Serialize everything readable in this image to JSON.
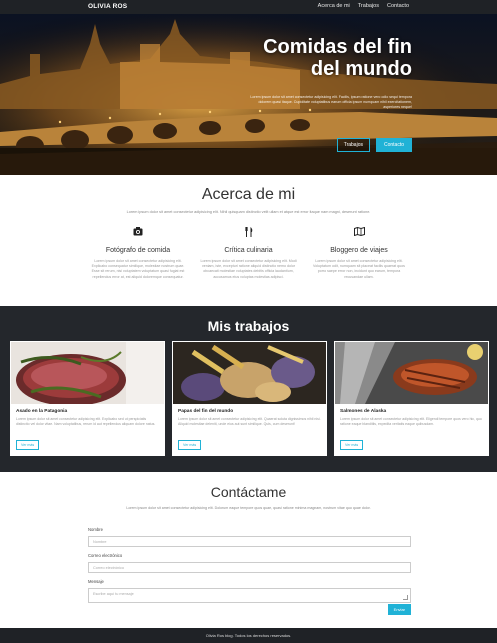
{
  "nav": {
    "brand": "OLIVIA ROS",
    "links": [
      "Acerca de mi",
      "Trabajos",
      "Contacto"
    ]
  },
  "hero": {
    "title": "Comidas del fin del mundo",
    "subtitle": "Lorem ipsum dolor sit amet consectetur adipisicing elit. Facilis, ipsum ratione vero odio sequi tempora dolorem quasi itaque. Cupiditate voluptatibus earum officia ipsum numquam nihil exercitationem, asperiores neque!",
    "buttons": [
      "Trabajos",
      "Contacto"
    ]
  },
  "about": {
    "title": "Acerca de mi",
    "lead": "Lorem ipsum dolor sit amet consectetur adipisicing elit. Nihil quisquam distinctio velit ullam et atque est error itaque nam magni, deserunt ratione.",
    "features": [
      {
        "icon": "camera-icon",
        "title": "Fotógrafo de comida",
        "text": "Lorem ipsum dolor sit amet consectetur adipisicing elit. Explicabo consequatur similique, molestiae nostrum quae. Esse sit rerum, nisi voluptatem voluptatum quasi fugiat est repellendus error at, est aliquid doloremque consequatur."
      },
      {
        "icon": "cutlery-icon",
        "title": "Crítica culinaria",
        "text": "Lorem ipsum dolor sit amet consectetur adipisicing elit. Modi veniam, iste, excepturi ratione aliquid distinctio nemo dolor obcaecati molestiae voluptates debitis officia laudantium, accusamus eius voluptas molestias adipisci."
      },
      {
        "icon": "map-icon",
        "title": "Bloggero de viajes",
        "text": "Lorem ipsum dolor sit amet consectetur adipisicing elit. Voluptatum odit, numquam sit placeat facilis quaerat quos porro saepe error non, incidunt quo earum, tempora recusandae ullam."
      }
    ]
  },
  "works": {
    "title": "Mis trabajos",
    "cards": [
      {
        "title": "Asado en la Patagonia",
        "text": "Lorem ipsum dolor sit amet consectetur adipisicing elit. Explicabo sed ut perspiciatis distinctio vel dolor vitae. Nam voluptatibus, rerum id aut repellendus aliquam dolore natus.",
        "button": "Ver más"
      },
      {
        "title": "Papas del fin del mundo",
        "text": "Lorem ipsum dolor sit amet consectetur adipisicing elit. Quaerat soluta dignissimos nihil nisi. Aliquid molestiae deleniti, unde eius aut sunt similique. Quis, cum deserunt!",
        "button": "Ver más"
      },
      {
        "title": "Salmones de Alaska",
        "text": "Lorem ipsum dolor sit amet consectetur adipisicing elit. Eligendi tempore quos vero hic, quo ratione eaque blanditiis, expedita veritatis eaque quibusdam.",
        "button": "Ver más"
      }
    ]
  },
  "contact": {
    "title": "Contáctame",
    "lead": "Lorem ipsum dolor sit amet consectetur adipisicing elit. Dolorum eaque tempore quos quae, quasi ratione minima magnam, nostrum vitae quo quae dolor.",
    "name_label": "Nombre",
    "name_placeholder": "Nombre",
    "email_label": "Correo electrónico",
    "email_placeholder": "Correo electrónico",
    "message_label": "Mensaje",
    "message_placeholder": "Escribe aquí tu mensaje",
    "send": "Enviar"
  },
  "footer": {
    "text": "Olivia Ros blog. Todos los derechos reservados."
  },
  "colors": {
    "accent": "#20b2d6",
    "dark": "#24272c",
    "nav": "#1f2226"
  }
}
